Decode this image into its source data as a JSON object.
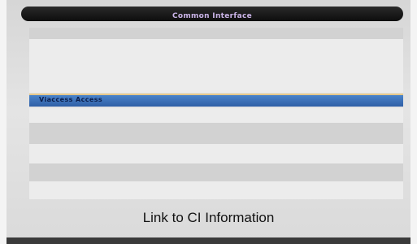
{
  "menu": {
    "title": "Common Interface",
    "selected_item": "Viaccess Access"
  },
  "caption": "Link to CI Information"
}
